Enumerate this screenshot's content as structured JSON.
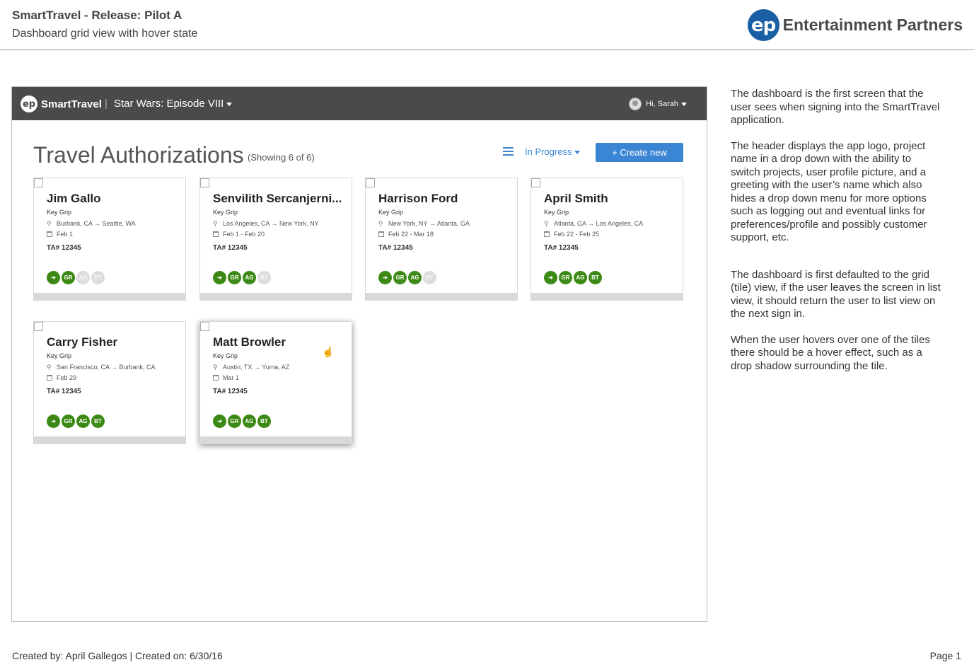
{
  "doc": {
    "title": "SmartTravel - Release: Pilot A",
    "subtitle": "Dashboard grid view with hover state",
    "brand_logo": "ep",
    "brand_name": "Entertainment Partners"
  },
  "app": {
    "logo": "ep",
    "name": "SmartTravel",
    "separator": "|",
    "project": "Star Wars: Episode VIII",
    "greeting": "Hi, Sarah"
  },
  "dashboard": {
    "title": "Travel Authorizations",
    "count": "(Showing 6 of 6)",
    "filter": "In Progress",
    "create_label": "+ Create new"
  },
  "tiles": [
    {
      "name": "Jim Gallo",
      "role": "Key Grip",
      "route": "Burbank, CA → Seattle, WA",
      "dates": "Feb 1",
      "ta": "TA# 12345",
      "badges": [
        {
          "label": "",
          "on": true
        },
        {
          "label": "GR",
          "on": true
        },
        {
          "label": "AG",
          "on": false
        },
        {
          "label": "BT",
          "on": false
        }
      ]
    },
    {
      "name": "Senvilith Sercanjerni...",
      "role": "Key Grip",
      "route": "Los Angeles, CA → New York, NY",
      "dates": "Feb 1 - Feb 20",
      "ta": "TA# 12345",
      "badges": [
        {
          "label": "",
          "on": true
        },
        {
          "label": "GR",
          "on": true
        },
        {
          "label": "AG",
          "on": true
        },
        {
          "label": "BT",
          "on": false
        }
      ]
    },
    {
      "name": "Harrison Ford",
      "role": "Key Grip",
      "route": "New York, NY → Atlanta, GA",
      "dates": "Feb 22 - Mar 18",
      "ta": "TA# 12345",
      "badges": [
        {
          "label": "",
          "on": true
        },
        {
          "label": "GR",
          "on": true
        },
        {
          "label": "AG",
          "on": true
        },
        {
          "label": "BT",
          "on": false
        }
      ]
    },
    {
      "name": "April Smith",
      "role": "Key Grip",
      "route": "Atlanta, GA → Los Angeles, CA",
      "dates": "Feb 22 - Feb 25",
      "ta": "TA# 12345",
      "badges": [
        {
          "label": "",
          "on": true
        },
        {
          "label": "GR",
          "on": true
        },
        {
          "label": "AG",
          "on": true
        },
        {
          "label": "BT",
          "on": true
        }
      ]
    },
    {
      "name": "Carry Fisher",
      "role": "Key Grip",
      "route": "San Francisco, CA → Burbank, CA",
      "dates": "Feb 29",
      "ta": "TA# 12345",
      "badges": [
        {
          "label": "",
          "on": true
        },
        {
          "label": "GR",
          "on": true
        },
        {
          "label": "AG",
          "on": true
        },
        {
          "label": "BT",
          "on": true
        }
      ]
    },
    {
      "name": "Matt Browler",
      "role": "Key Grip",
      "route": "Austin, TX → Yuma, AZ",
      "dates": "Mar 1",
      "ta": "TA# 12345",
      "badges": [
        {
          "label": "",
          "on": true
        },
        {
          "label": "GR",
          "on": true
        },
        {
          "label": "AG",
          "on": true
        },
        {
          "label": "BT",
          "on": true
        }
      ]
    }
  ],
  "notes": [
    "The dashboard is the first screen that the user sees when signing into the SmartTravel application.",
    "The header displays the app logo, project name in a drop down with the ability to switch projects, user profile picture, and a greeting with the user’s name which also hides a drop down menu for more options such as logging out and eventual links for preferences/profile and possibly customer support, etc.",
    "The dashboard is first defaulted to the grid (tile) view, if the user leaves the screen in list view, it should return the user to list view on the next sign in.",
    "When the user hovers over one of the tiles there should be a hover effect, such as a drop shadow surrounding the tile."
  ],
  "footer": {
    "created": "Created by: April Gallegos | Created on: 6/30/16",
    "page": "Page 1"
  },
  "colors": {
    "accent": "#3b86d4",
    "badge_on": "#3c8a15",
    "badge_off": "#dddddd",
    "app_bar": "#4a4a4a",
    "brand": "#1a5fa3"
  }
}
